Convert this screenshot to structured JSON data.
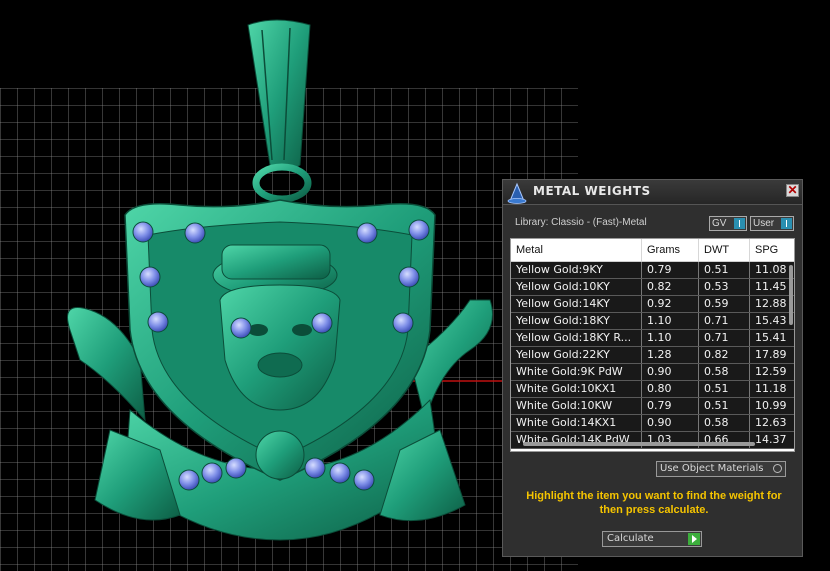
{
  "panel": {
    "title": "METAL WEIGHTS",
    "close_glyph": "✕",
    "library_label": "Library: Classio - (Fast)-Metal",
    "gv_label": "GV",
    "user_label": "User",
    "use_object_materials_label": "Use Object Materials",
    "hint": "Highlight the item you want to find the weight for then press calculate.",
    "calculate_label": "Calculate",
    "colors": {
      "hint": "#f5c400",
      "toggle_knob": "#2a8fb0",
      "calc_arrow": "#3cae3c"
    }
  },
  "table": {
    "headers": [
      "Metal",
      "Grams",
      "DWT",
      "SPG"
    ],
    "rows": [
      [
        "Yellow Gold:9KY",
        "0.79",
        "0.51",
        "11.08"
      ],
      [
        "Yellow Gold:10KY",
        "0.82",
        "0.53",
        "11.45"
      ],
      [
        "Yellow Gold:14KY",
        "0.92",
        "0.59",
        "12.88"
      ],
      [
        "Yellow Gold:18KY",
        "1.10",
        "0.71",
        "15.43"
      ],
      [
        "Yellow Gold:18KY R...",
        "1.10",
        "0.71",
        "15.41"
      ],
      [
        "Yellow Gold:22KY",
        "1.28",
        "0.82",
        "17.89"
      ],
      [
        "White Gold:9K PdW",
        "0.90",
        "0.58",
        "12.59"
      ],
      [
        "White Gold:10KX1",
        "0.80",
        "0.51",
        "11.18"
      ],
      [
        "White Gold:10KW",
        "0.79",
        "0.51",
        "10.99"
      ],
      [
        "White Gold:14KX1",
        "0.90",
        "0.58",
        "12.63"
      ],
      [
        "White Gold:14K PdW",
        "1.03",
        "0.66",
        "14.37"
      ]
    ]
  },
  "viewport": {
    "colors": {
      "model": "#1f9e7a",
      "model_dark": "#0d5e45",
      "gem": "#7f8fe8",
      "grid": "#8a8a8a",
      "axis": "#c01010"
    },
    "icons": [
      "pendant-model",
      "grid-floor",
      "axis-line"
    ]
  }
}
